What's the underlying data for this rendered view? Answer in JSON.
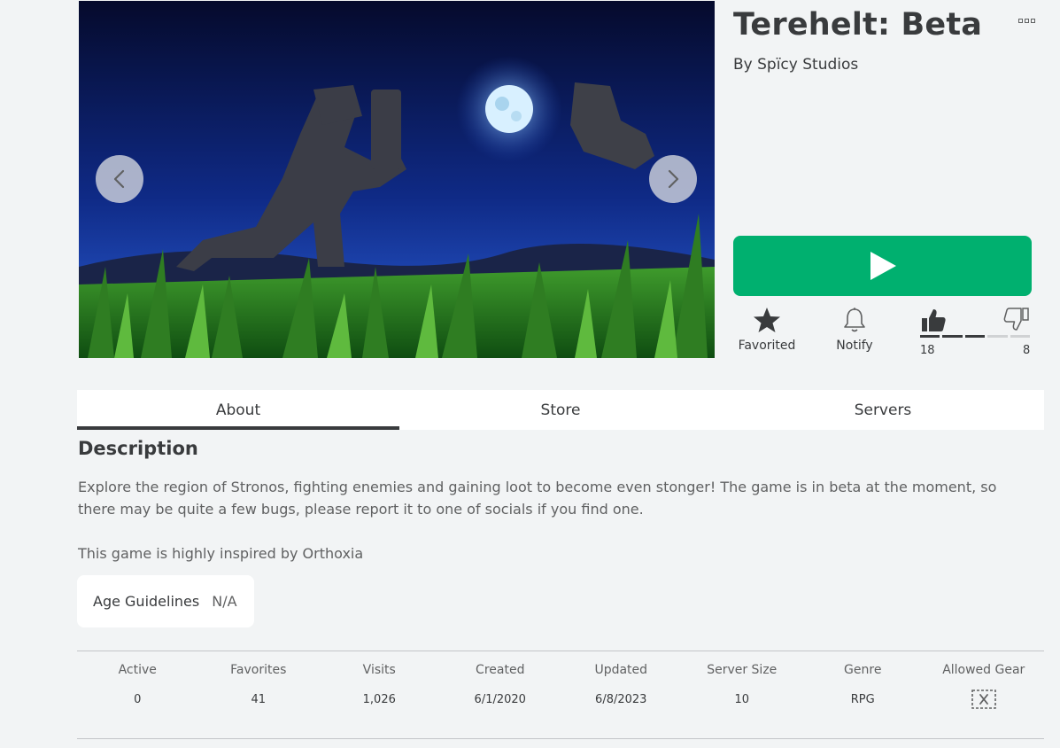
{
  "game": {
    "title": "Terehelt: Beta",
    "creator": "By Spïcy Studios"
  },
  "media": {
    "prev_icon": "chevron-left-icon",
    "next_icon": "chevron-right-icon"
  },
  "play": {
    "icon": "play-icon",
    "color": "#00b06f"
  },
  "actions": {
    "favorite_label": "Favorited",
    "favorite_icon": "star-icon",
    "notify_label": "Notify",
    "notify_icon": "bell-icon"
  },
  "votes": {
    "up": "18",
    "down": "8",
    "up_fraction": 0.69,
    "up_icon": "thumbs-up-icon",
    "down_icon": "thumbs-down-icon"
  },
  "tabs": [
    {
      "label": "About",
      "active": true
    },
    {
      "label": "Store",
      "active": false
    },
    {
      "label": "Servers",
      "active": false
    }
  ],
  "about": {
    "heading": "Description",
    "description": "Explore the region of Stronos, fighting enemies and gaining loot to become even stonger! The game is in beta at the moment, so there may be quite a few bugs, please report it to one of socials if you find one.",
    "inspired": "This game is highly inspired by Orthoxia",
    "age_label": "Age Guidelines",
    "age_value": "N/A"
  },
  "stats": [
    {
      "label": "Active",
      "value": "0"
    },
    {
      "label": "Favorites",
      "value": "41"
    },
    {
      "label": "Visits",
      "value": "1,026"
    },
    {
      "label": "Created",
      "value": "6/1/2020"
    },
    {
      "label": "Updated",
      "value": "6/8/2023"
    },
    {
      "label": "Server Size",
      "value": "10"
    },
    {
      "label": "Genre",
      "value": "RPG"
    },
    {
      "label": "Allowed Gear",
      "value": null,
      "icon": "gear-not-allowed-icon"
    }
  ]
}
